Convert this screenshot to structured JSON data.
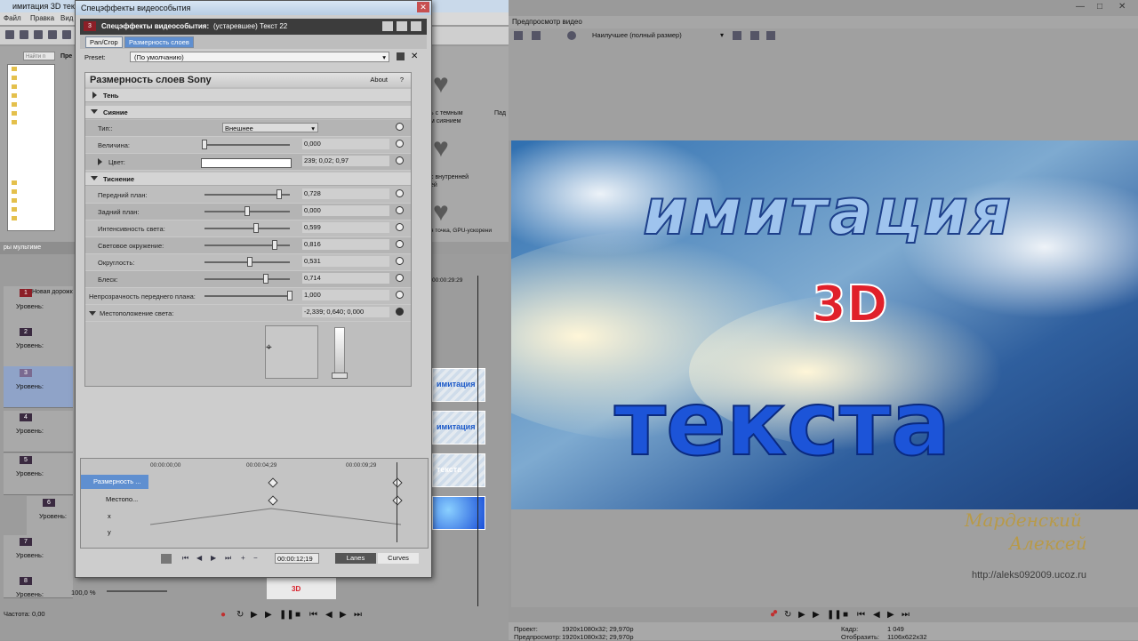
{
  "main_window": {
    "title": "имитация 3D текст",
    "menu": [
      "Файл",
      "Правка",
      "Вид"
    ],
    "explorer_label": "Найти п",
    "explorer_header": "Пре",
    "explorer_tab": "ры мультиме",
    "media_captions": [
      "ь с темным",
      "м сиянием",
      "Пад",
      "с внутренней",
      "ей",
      "я точка, GPU-ускорени"
    ],
    "tracks": [
      {
        "num": "1",
        "name": "Новая дорожк",
        "level": "Уровень:"
      },
      {
        "num": "2",
        "name": "",
        "level": "Уровень:"
      },
      {
        "num": "3",
        "name": "",
        "level": "Уровень:"
      },
      {
        "num": "4",
        "name": "",
        "level": "Уровень:"
      },
      {
        "num": "5",
        "name": "",
        "level": "Уровень:"
      },
      {
        "num": "6",
        "name": "",
        "level": "Уровень:"
      },
      {
        "num": "7",
        "name": "",
        "level": "Уровень:"
      },
      {
        "num": "8",
        "name": "",
        "level": "Уровень:"
      }
    ],
    "track8_level_value": "100,0 %",
    "ruler_time": "00:00:29:29",
    "rate_label": "Частота: 0,00",
    "clips": [
      "имитация",
      "имитация",
      "текста",
      ""
    ],
    "small_clip_text": "3D"
  },
  "fx_dialog": {
    "title": "Спецэффекты видеособытия",
    "chain_label": "Спецэффекты видеособытия:",
    "chain_value": "(устаревшее) Текст 22",
    "tab_pancrop": "Pan/Crop",
    "tab_active": "Размерность слоев",
    "preset_label": "Preset:",
    "preset_value": "(По умолчанию)",
    "plugin_title": "Размерность слоев Sony",
    "about": "About",
    "help": "?",
    "sections": {
      "shadow": "Тень",
      "glow": "Сияние",
      "emboss": "Тиснение"
    },
    "glow_rows": {
      "type_label": "Тип::",
      "type_value": "Внешнее",
      "size_label": "Величина:",
      "size_value": "0,000",
      "size_level": 0.0,
      "color_label": "Цвет:",
      "color_value": "239; 0,02; 0,97"
    },
    "emboss_rows": [
      {
        "label": "Передний план:",
        "value": "0,728",
        "level": 0.87
      },
      {
        "label": "Задний план:",
        "value": "0,000",
        "level": 0.5
      },
      {
        "label": "Интенсивность света:",
        "value": "0,599",
        "level": 0.6
      },
      {
        "label": "Световое окружение:",
        "value": "0,816",
        "level": 0.82
      },
      {
        "label": "Округлость:",
        "value": "0,531",
        "level": 0.53
      },
      {
        "label": "Блеск:",
        "value": "0,714",
        "level": 0.72
      }
    ],
    "opacity_label": "Непрозрачность переднего плана:",
    "opacity_value": "1,000",
    "opacity_level": 1.0,
    "light_pos_label": "Местоположение света:",
    "light_pos_value": "-2,339; 0,640; 0,000",
    "timeline": {
      "times": [
        "00:00:00;00",
        "00:00:04;29",
        "00:00:09;29"
      ],
      "rows": [
        "Размерность ...",
        "Местопо...",
        "x",
        "y"
      ]
    },
    "bottom_time": "00:00:12;19",
    "lanes": "Lanes",
    "curves": "Curves"
  },
  "preview": {
    "title": "Предпросмотр видео",
    "quality": "Наилучшее (полный размер)",
    "line1": "имитация",
    "line2": "3D",
    "line3": "текста",
    "signature1": "Марденский",
    "signature2": "Алексей",
    "url": "http://aleks092009.ucoz.ru",
    "footer": {
      "project_label": "Проект:",
      "project_value": "1920x1080x32; 29,970p",
      "preview_label": "Предпросмотр:",
      "preview_value": "1920x1080x32; 29,970p",
      "frame_label": "Кадр:",
      "frame_value": "1 049",
      "display_label": "Отобразить:",
      "display_value": "1106x622x32"
    }
  }
}
